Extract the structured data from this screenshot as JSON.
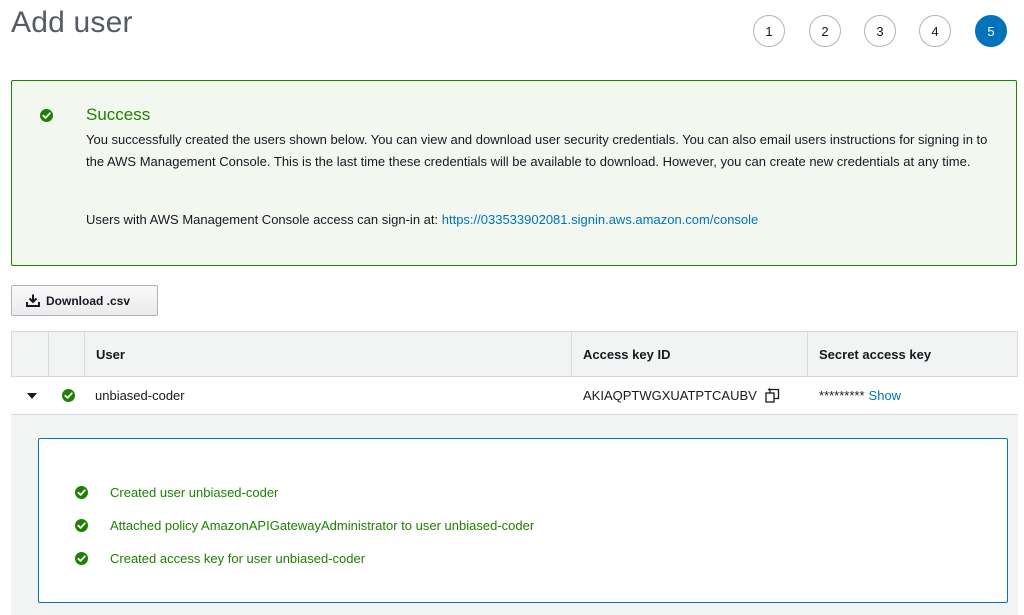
{
  "header": {
    "title": "Add user",
    "steps": [
      "1",
      "2",
      "3",
      "4",
      "5"
    ],
    "active_step": "5"
  },
  "success": {
    "title": "Success",
    "body": "You successfully created the users shown below. You can view and download user security credentials. You can also email users instructions for signing in to the AWS Management Console. This is the last time these credentials will be available to download. However, you can create new credentials at any time.",
    "signin_prefix": "Users with AWS Management Console access can sign-in at: ",
    "signin_url": "https://033533902081.signin.aws.amazon.com/console"
  },
  "toolbar": {
    "download_label": "Download .csv"
  },
  "table": {
    "columns": [
      "User",
      "Access key ID",
      "Secret access key"
    ],
    "rows": [
      {
        "user": "unbiased-coder",
        "access_key_id": "AKIAQPTWGXUATPTCAUBV",
        "secret_masked": "*********",
        "show_label": "Show",
        "details": [
          "Created user unbiased-coder",
          "Attached policy AmazonAPIGatewayAdministrator to user unbiased-coder",
          "Created access key for user unbiased-coder"
        ]
      }
    ]
  },
  "colors": {
    "success_green": "#1d8102",
    "link_blue": "#0073bb",
    "success_bg": "#f2f8f0",
    "header_gray": "#f2f3f3"
  },
  "icons": [
    "check-circle-icon",
    "download-icon",
    "caret-down-icon",
    "copy-icon"
  ]
}
